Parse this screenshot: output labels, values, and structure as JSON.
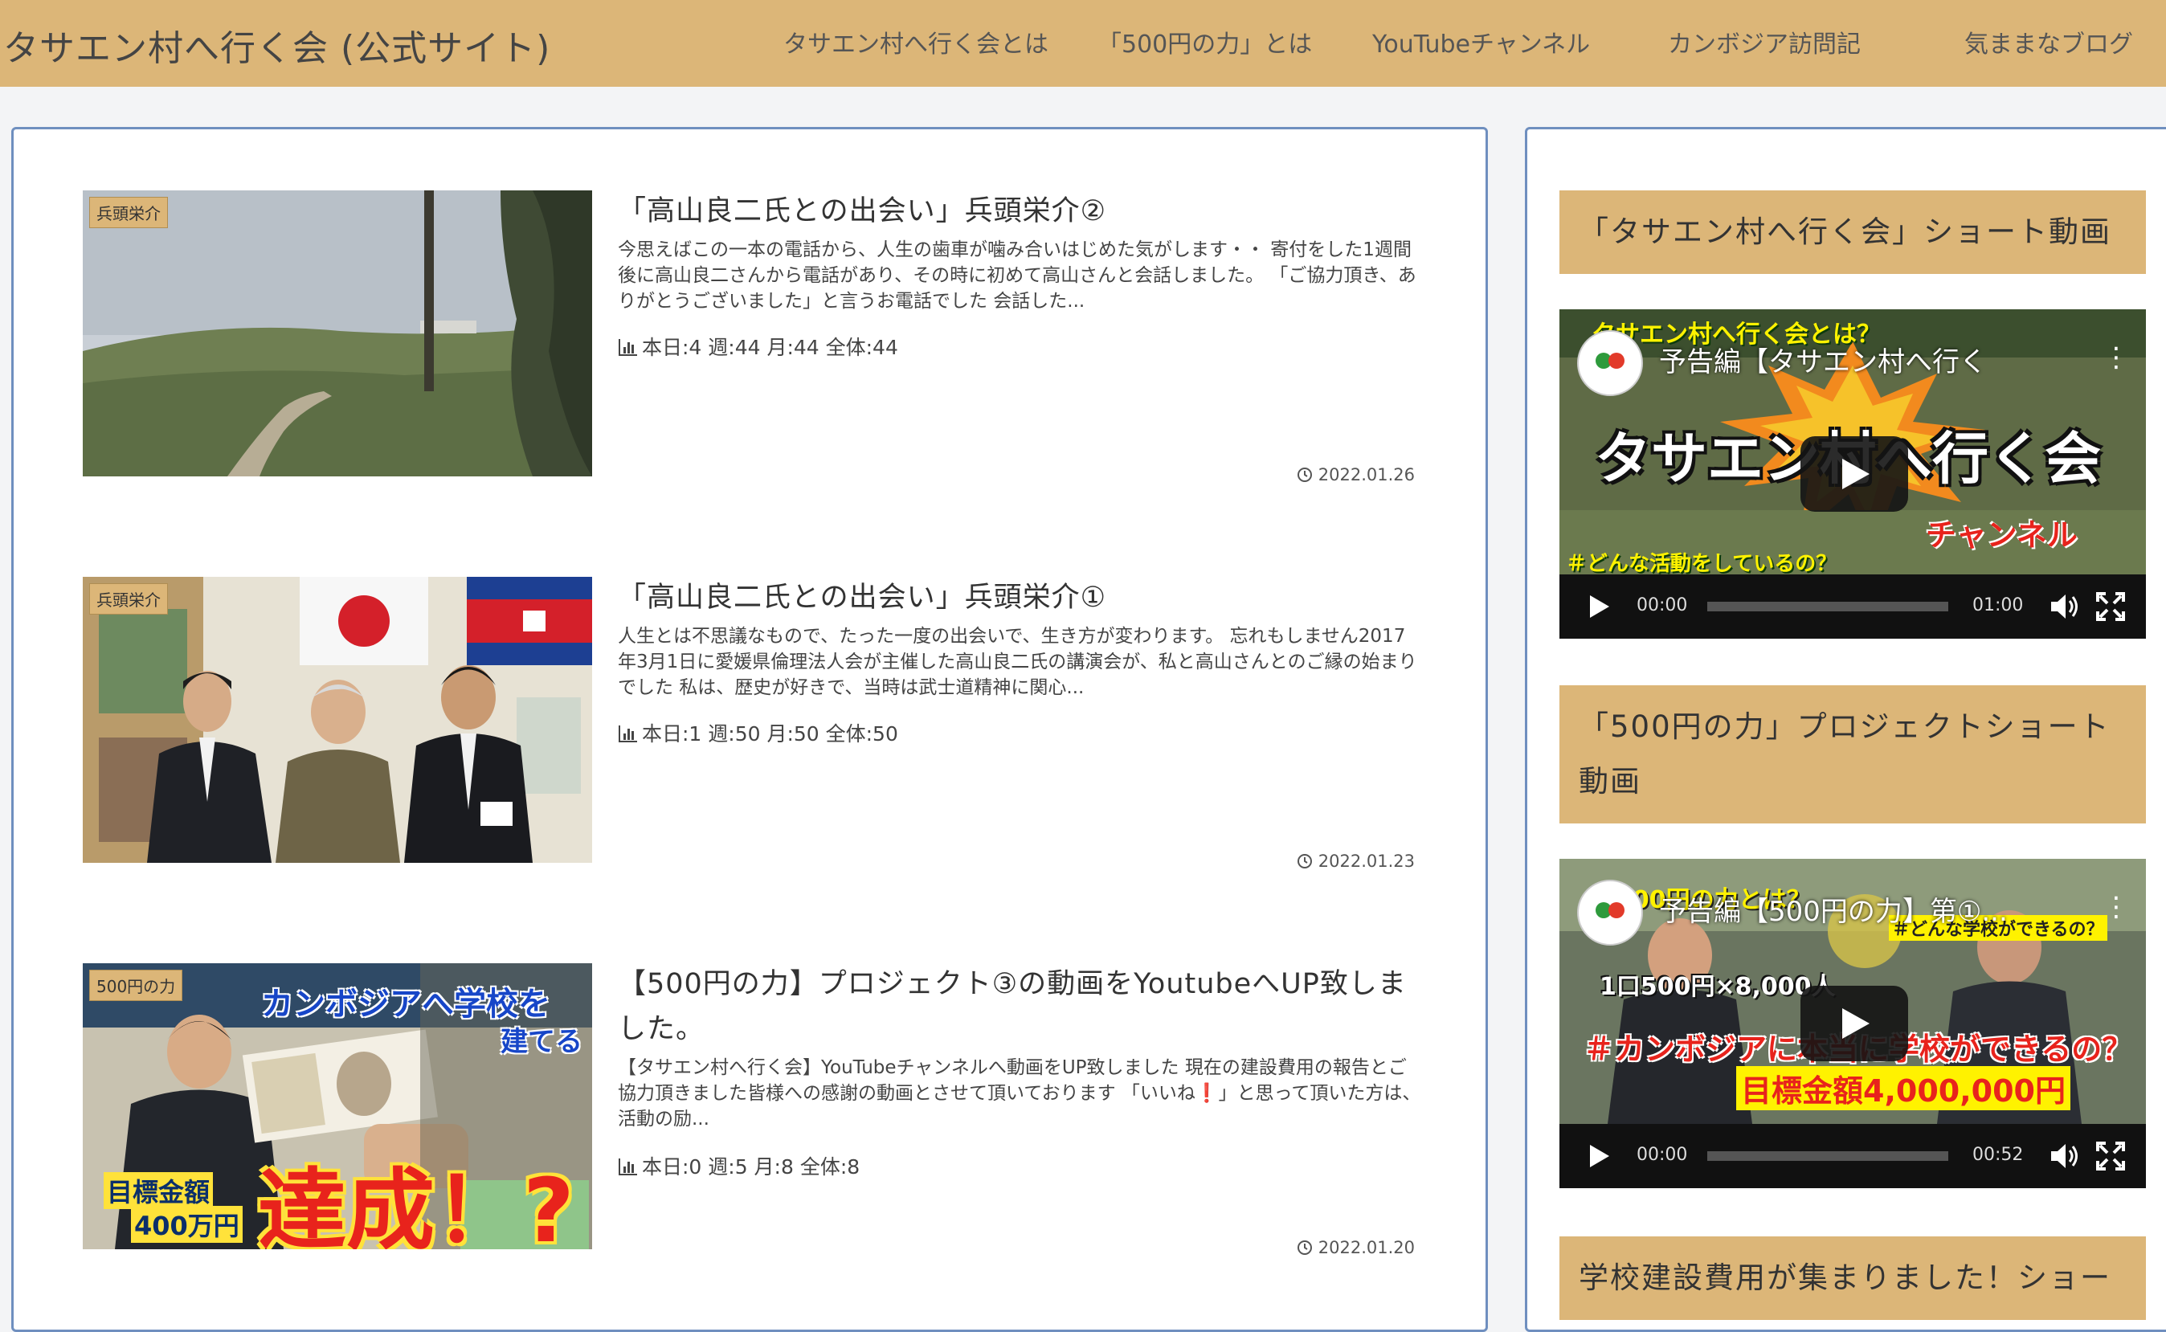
{
  "header": {
    "site_title": "タサエン村へ行く会 (公式サイト)",
    "nav": [
      "タサエン村へ行く会とは",
      "「500円の力」とは",
      "YouTubeチャンネル",
      "カンボジア訪問記",
      "気ままなブログ"
    ]
  },
  "articles": [
    {
      "category": "兵頭栄介",
      "title": "「高山良二氏との出会い」兵頭栄介②",
      "excerpt": "今思えばこの一本の電話から、人生の歯車が噛み合いはじめた気がします・・ 寄付をした1週間後に高山良二さんから電話があり、その時に初めて高山さんと会話しました。 「ご協力頂き、ありがとうございました」と言うお電話でした 会話した...",
      "stats": "本日:4  週:44  月:44  全体:44",
      "date": "2022.01.26"
    },
    {
      "category": "兵頭栄介",
      "title": "「高山良二氏との出会い」兵頭栄介①",
      "excerpt": "人生とは不思議なもので、たった一度の出会いで、生き方が変わります。 忘れもしません2017年3月1日に愛媛県倫理法人会が主催した高山良二氏の講演会が、私と高山さんとのご縁の始まりでした 私は、歴史が好きで、当時は武士道精神に関心...",
      "stats": "本日:1  週:50  月:50  全体:50",
      "date": "2022.01.23"
    },
    {
      "category": "500円の力",
      "title": "【500円の力】プロジェクト③の動画をYoutubeへUP致しました。",
      "excerpt": "【タサエン村へ行く会】YouTubeチャンネルへ動画をUP致しました 現在の建設費用の報告とご協力頂きました皆様への感謝の動画とさせて頂いております 「いいね❗️」と思って頂いた方は、活動の励...",
      "stats": "本日:0  週:5  月:8  全体:8",
      "date": "2022.01.20",
      "thumb_text": {
        "headline": "カンボジアへ学校を",
        "subline": "建てる",
        "goal": "目標金額",
        "goal_amount": "400万円",
        "big": "達成！?"
      }
    }
  ],
  "sidebar": {
    "widgets": [
      {
        "title": "「タサエン村へ行く会」ショート動画",
        "video_title": "予告編【タサエン村へ行く",
        "overlay_top": "タサエン村へ行く会とは？",
        "overlay_big": "タサエン村へ行く会",
        "overlay_channel": "チャンネル",
        "overlay_bottom": "＃どんな活動をしているの？",
        "time_current": "00:00",
        "time_total": "01:00"
      },
      {
        "title": "「500円の力」プロジェクトショート動画",
        "video_title": "予告編【500円の力】第①...",
        "overlay_top": "500円の力とは？",
        "overlay_tag": "＃どんな学校ができるの？",
        "overlay_price": "1口500円×8,000人",
        "overlay_q": "＃カンボジアに本当に学校ができるの？",
        "overlay_goal": "目標金額4,000,000円",
        "time_current": "00:00",
        "time_total": "00:52"
      },
      {
        "title": "学校建設費用が集まりました！ショー"
      }
    ]
  },
  "colors": {
    "header_bg": "#dcb678",
    "card_border": "#6f8fbf",
    "badge_bg": "#dcb678"
  }
}
